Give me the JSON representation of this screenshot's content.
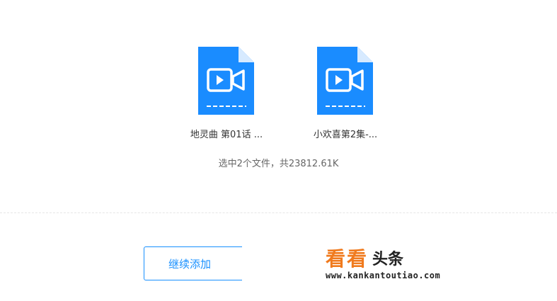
{
  "files": [
    {
      "name": "地灵曲 第01话 ...",
      "icon": "video-file-icon"
    },
    {
      "name": "小欢喜第2集-...",
      "icon": "video-file-icon"
    }
  ],
  "summary": "选中2个文件，共23812.61K",
  "add_button_label": "继续添加",
  "watermark": {
    "main": "看看",
    "sub": "头条",
    "url": "www.kankantoutiao.com"
  },
  "colors": {
    "accent": "#1890ff",
    "file_icon": "#1a8cff",
    "watermark_orange": "#f07a1d"
  }
}
